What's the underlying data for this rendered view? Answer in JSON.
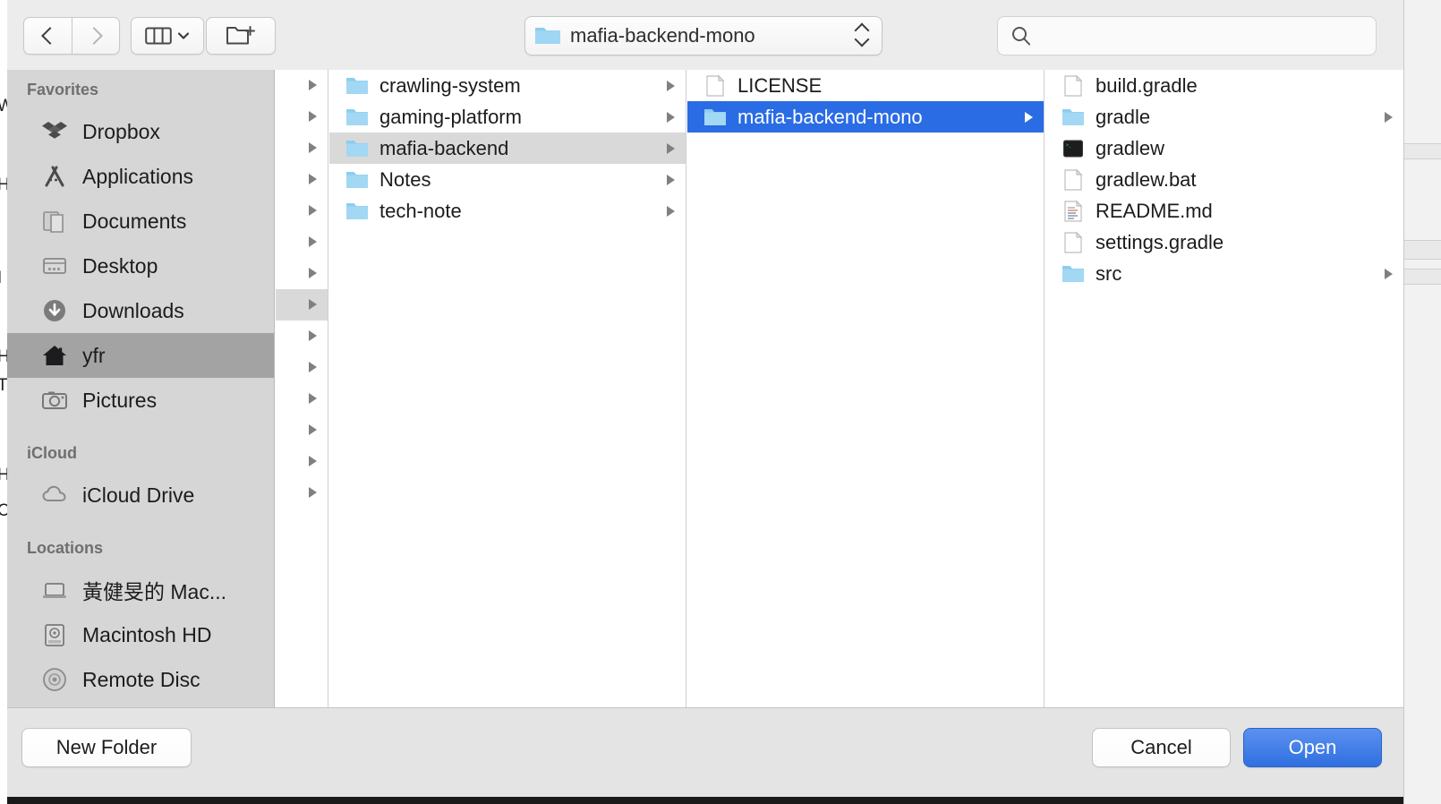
{
  "window": {
    "title": "mafia-backend-mono",
    "accent_blue": "#2a6ce4",
    "sidebar_bg": "#d6d6d6",
    "toolbar_bg": "#ececec"
  },
  "toolbar": {
    "back_icon": "chevron-left-icon",
    "forward_icon": "chevron-right-icon",
    "view_icon": "column-view-icon",
    "view_chevron_icon": "chevron-down-icon",
    "new_folder_icon": "new-folder-icon",
    "path_label": "mafia-backend-mono",
    "path_folder_icon": "folder-icon",
    "path_stepper_icon": "up-down-chevron-icon"
  },
  "search": {
    "icon": "search-icon",
    "value": "",
    "placeholder": ""
  },
  "sidebar": {
    "sections": [
      {
        "header": "Favorites",
        "items": [
          {
            "label": "Dropbox",
            "icon": "dropbox-icon",
            "selected": false
          },
          {
            "label": "Applications",
            "icon": "applications-icon",
            "selected": false
          },
          {
            "label": "Documents",
            "icon": "documents-icon",
            "selected": false
          },
          {
            "label": "Desktop",
            "icon": "desktop-icon",
            "selected": false
          },
          {
            "label": "Downloads",
            "icon": "downloads-icon",
            "selected": false
          },
          {
            "label": "yfr",
            "icon": "home-icon",
            "selected": true
          },
          {
            "label": "Pictures",
            "icon": "pictures-icon",
            "selected": false
          }
        ]
      },
      {
        "header": "iCloud",
        "items": [
          {
            "label": "iCloud Drive",
            "icon": "cloud-icon",
            "selected": false
          }
        ]
      },
      {
        "header": "Locations",
        "items": [
          {
            "label": "黃健旻的 Mac...",
            "icon": "laptop-icon",
            "selected": false
          },
          {
            "label": "Macintosh HD",
            "icon": "harddisk-icon",
            "selected": false
          },
          {
            "label": "Remote Disc",
            "icon": "optical-disc-icon",
            "selected": false
          }
        ]
      }
    ]
  },
  "columns": [
    {
      "name": "column-scrolled-partial",
      "rows": [
        {
          "label": "",
          "icon": "none",
          "disclosure": true,
          "selected": false
        },
        {
          "label": "",
          "icon": "none",
          "disclosure": true,
          "selected": false
        },
        {
          "label": "",
          "icon": "none",
          "disclosure": true,
          "selected": false
        },
        {
          "label": "",
          "icon": "none",
          "disclosure": true,
          "selected": false
        },
        {
          "label": "",
          "icon": "none",
          "disclosure": true,
          "selected": false
        },
        {
          "label": "",
          "icon": "none",
          "disclosure": true,
          "selected": false
        },
        {
          "label": "",
          "icon": "none",
          "disclosure": true,
          "selected": false
        },
        {
          "label": "",
          "icon": "none",
          "disclosure": true,
          "selected": true
        },
        {
          "label": "",
          "icon": "none",
          "disclosure": true,
          "selected": false
        },
        {
          "label": "",
          "icon": "none",
          "disclosure": true,
          "selected": false
        },
        {
          "label": "",
          "icon": "none",
          "disclosure": true,
          "selected": false
        },
        {
          "label": "",
          "icon": "none",
          "disclosure": true,
          "selected": false
        },
        {
          "label": "",
          "icon": "none",
          "disclosure": true,
          "selected": false
        },
        {
          "label": "",
          "icon": "none",
          "disclosure": true,
          "selected": false
        }
      ]
    },
    {
      "name": "column-projects",
      "rows": [
        {
          "label": "crawling-system",
          "icon": "folder-icon",
          "disclosure": true,
          "selected": false
        },
        {
          "label": "gaming-platform",
          "icon": "folder-icon",
          "disclosure": true,
          "selected": false
        },
        {
          "label": "mafia-backend",
          "icon": "folder-icon",
          "disclosure": true,
          "selected": true
        },
        {
          "label": "Notes",
          "icon": "folder-icon",
          "disclosure": true,
          "selected": false
        },
        {
          "label": "tech-note",
          "icon": "folder-icon",
          "disclosure": true,
          "selected": false
        }
      ]
    },
    {
      "name": "column-mafia-backend",
      "rows": [
        {
          "label": "LICENSE",
          "icon": "file-icon",
          "disclosure": false,
          "selected": false
        },
        {
          "label": "mafia-backend-mono",
          "icon": "folder-icon",
          "disclosure": true,
          "selected": true
        }
      ]
    },
    {
      "name": "column-mafia-backend-mono",
      "rows": [
        {
          "label": "build.gradle",
          "icon": "file-icon",
          "disclosure": false,
          "selected": false
        },
        {
          "label": "gradle",
          "icon": "folder-icon",
          "disclosure": true,
          "selected": false
        },
        {
          "label": "gradlew",
          "icon": "terminal-icon",
          "disclosure": false,
          "selected": false
        },
        {
          "label": "gradlew.bat",
          "icon": "file-icon",
          "disclosure": false,
          "selected": false
        },
        {
          "label": "README.md",
          "icon": "markdown-icon",
          "disclosure": false,
          "selected": false
        },
        {
          "label": "settings.gradle",
          "icon": "file-icon",
          "disclosure": false,
          "selected": false
        },
        {
          "label": "src",
          "icon": "folder-icon",
          "disclosure": true,
          "selected": false
        }
      ]
    }
  ],
  "footer": {
    "new_folder_label": "New Folder",
    "cancel_label": "Cancel",
    "open_label": "Open"
  },
  "background_fragments": [
    "W",
    "H",
    "I",
    "H",
    "T",
    "H",
    "C"
  ]
}
